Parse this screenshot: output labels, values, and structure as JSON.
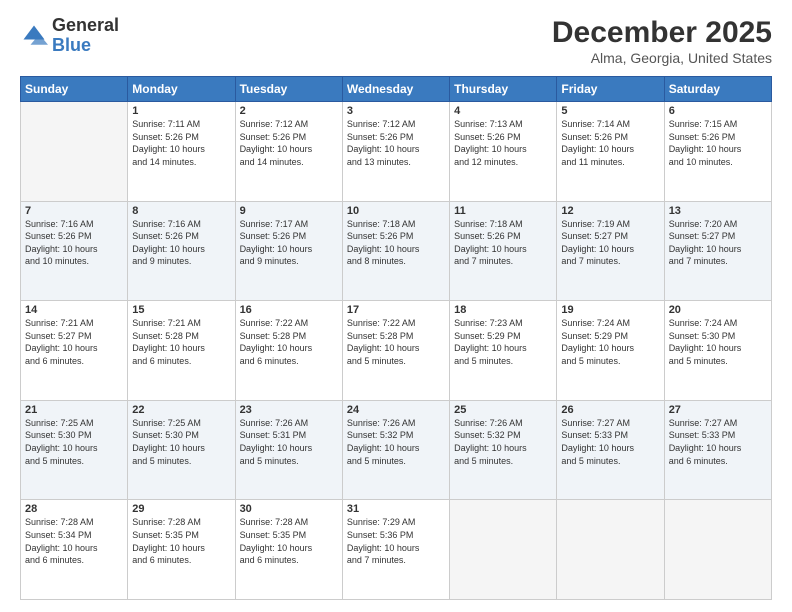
{
  "logo": {
    "general": "General",
    "blue": "Blue"
  },
  "header": {
    "month": "December 2025",
    "location": "Alma, Georgia, United States"
  },
  "weekdays": [
    "Sunday",
    "Monday",
    "Tuesday",
    "Wednesday",
    "Thursday",
    "Friday",
    "Saturday"
  ],
  "weeks": [
    [
      {
        "day": "",
        "info": ""
      },
      {
        "day": "1",
        "info": "Sunrise: 7:11 AM\nSunset: 5:26 PM\nDaylight: 10 hours\nand 14 minutes."
      },
      {
        "day": "2",
        "info": "Sunrise: 7:12 AM\nSunset: 5:26 PM\nDaylight: 10 hours\nand 14 minutes."
      },
      {
        "day": "3",
        "info": "Sunrise: 7:12 AM\nSunset: 5:26 PM\nDaylight: 10 hours\nand 13 minutes."
      },
      {
        "day": "4",
        "info": "Sunrise: 7:13 AM\nSunset: 5:26 PM\nDaylight: 10 hours\nand 12 minutes."
      },
      {
        "day": "5",
        "info": "Sunrise: 7:14 AM\nSunset: 5:26 PM\nDaylight: 10 hours\nand 11 minutes."
      },
      {
        "day": "6",
        "info": "Sunrise: 7:15 AM\nSunset: 5:26 PM\nDaylight: 10 hours\nand 10 minutes."
      }
    ],
    [
      {
        "day": "7",
        "info": "Sunrise: 7:16 AM\nSunset: 5:26 PM\nDaylight: 10 hours\nand 10 minutes."
      },
      {
        "day": "8",
        "info": "Sunrise: 7:16 AM\nSunset: 5:26 PM\nDaylight: 10 hours\nand 9 minutes."
      },
      {
        "day": "9",
        "info": "Sunrise: 7:17 AM\nSunset: 5:26 PM\nDaylight: 10 hours\nand 9 minutes."
      },
      {
        "day": "10",
        "info": "Sunrise: 7:18 AM\nSunset: 5:26 PM\nDaylight: 10 hours\nand 8 minutes."
      },
      {
        "day": "11",
        "info": "Sunrise: 7:18 AM\nSunset: 5:26 PM\nDaylight: 10 hours\nand 7 minutes."
      },
      {
        "day": "12",
        "info": "Sunrise: 7:19 AM\nSunset: 5:27 PM\nDaylight: 10 hours\nand 7 minutes."
      },
      {
        "day": "13",
        "info": "Sunrise: 7:20 AM\nSunset: 5:27 PM\nDaylight: 10 hours\nand 7 minutes."
      }
    ],
    [
      {
        "day": "14",
        "info": "Sunrise: 7:21 AM\nSunset: 5:27 PM\nDaylight: 10 hours\nand 6 minutes."
      },
      {
        "day": "15",
        "info": "Sunrise: 7:21 AM\nSunset: 5:28 PM\nDaylight: 10 hours\nand 6 minutes."
      },
      {
        "day": "16",
        "info": "Sunrise: 7:22 AM\nSunset: 5:28 PM\nDaylight: 10 hours\nand 6 minutes."
      },
      {
        "day": "17",
        "info": "Sunrise: 7:22 AM\nSunset: 5:28 PM\nDaylight: 10 hours\nand 5 minutes."
      },
      {
        "day": "18",
        "info": "Sunrise: 7:23 AM\nSunset: 5:29 PM\nDaylight: 10 hours\nand 5 minutes."
      },
      {
        "day": "19",
        "info": "Sunrise: 7:24 AM\nSunset: 5:29 PM\nDaylight: 10 hours\nand 5 minutes."
      },
      {
        "day": "20",
        "info": "Sunrise: 7:24 AM\nSunset: 5:30 PM\nDaylight: 10 hours\nand 5 minutes."
      }
    ],
    [
      {
        "day": "21",
        "info": "Sunrise: 7:25 AM\nSunset: 5:30 PM\nDaylight: 10 hours\nand 5 minutes."
      },
      {
        "day": "22",
        "info": "Sunrise: 7:25 AM\nSunset: 5:30 PM\nDaylight: 10 hours\nand 5 minutes."
      },
      {
        "day": "23",
        "info": "Sunrise: 7:26 AM\nSunset: 5:31 PM\nDaylight: 10 hours\nand 5 minutes."
      },
      {
        "day": "24",
        "info": "Sunrise: 7:26 AM\nSunset: 5:32 PM\nDaylight: 10 hours\nand 5 minutes."
      },
      {
        "day": "25",
        "info": "Sunrise: 7:26 AM\nSunset: 5:32 PM\nDaylight: 10 hours\nand 5 minutes."
      },
      {
        "day": "26",
        "info": "Sunrise: 7:27 AM\nSunset: 5:33 PM\nDaylight: 10 hours\nand 5 minutes."
      },
      {
        "day": "27",
        "info": "Sunrise: 7:27 AM\nSunset: 5:33 PM\nDaylight: 10 hours\nand 6 minutes."
      }
    ],
    [
      {
        "day": "28",
        "info": "Sunrise: 7:28 AM\nSunset: 5:34 PM\nDaylight: 10 hours\nand 6 minutes."
      },
      {
        "day": "29",
        "info": "Sunrise: 7:28 AM\nSunset: 5:35 PM\nDaylight: 10 hours\nand 6 minutes."
      },
      {
        "day": "30",
        "info": "Sunrise: 7:28 AM\nSunset: 5:35 PM\nDaylight: 10 hours\nand 6 minutes."
      },
      {
        "day": "31",
        "info": "Sunrise: 7:29 AM\nSunset: 5:36 PM\nDaylight: 10 hours\nand 7 minutes."
      },
      {
        "day": "",
        "info": ""
      },
      {
        "day": "",
        "info": ""
      },
      {
        "day": "",
        "info": ""
      }
    ]
  ]
}
